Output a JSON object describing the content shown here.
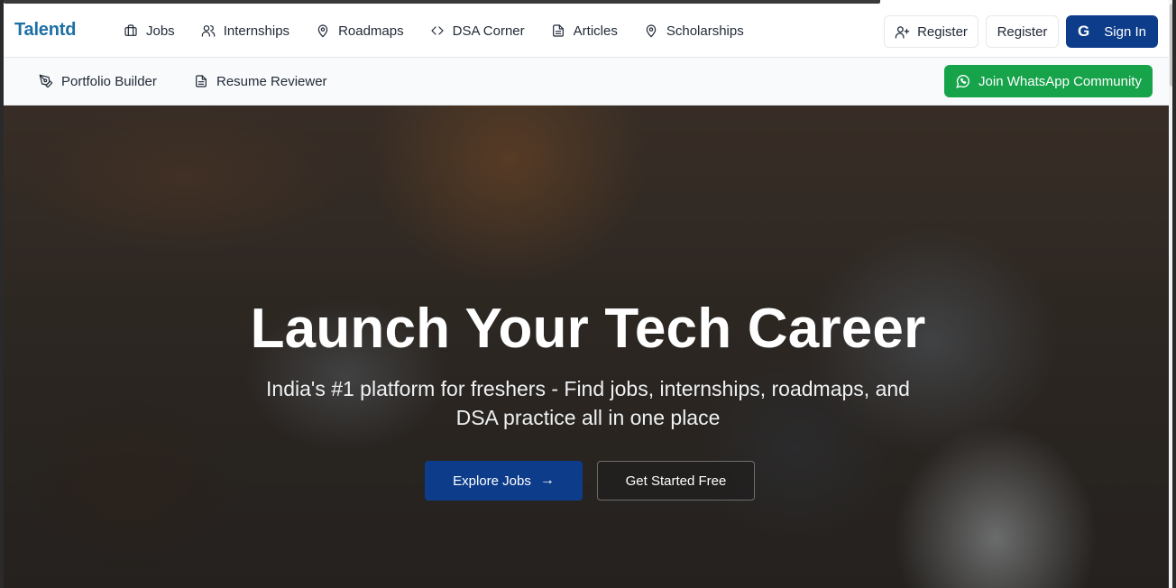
{
  "brand": {
    "name": "Talentd",
    "color": "#1d6fa5"
  },
  "nav_primary": [
    {
      "label": "Jobs",
      "icon": "briefcase-icon"
    },
    {
      "label": "Internships",
      "icon": "users-icon"
    },
    {
      "label": "Roadmaps",
      "icon": "map-pin-icon"
    },
    {
      "label": "DSA Corner",
      "icon": "code-icon"
    },
    {
      "label": "Articles",
      "icon": "file-text-icon"
    },
    {
      "label": "Scholarships",
      "icon": "map-pin-icon"
    }
  ],
  "header_actions": {
    "register_with_icon": "Register",
    "register": "Register",
    "sign_in": "Sign In",
    "sign_in_icon_glyph": "G"
  },
  "nav_secondary": [
    {
      "label": "Portfolio Builder",
      "icon": "pen-tool-icon"
    },
    {
      "label": "Resume Reviewer",
      "icon": "file-text-icon"
    }
  ],
  "whatsapp": {
    "label": "Join WhatsApp Community",
    "color": "#16a34a"
  },
  "hero": {
    "title": "Launch Your Tech Career",
    "subtitle": "India's #1 platform for freshers - Find jobs, internships, roadmaps, and DSA practice all in one place",
    "primary_cta": "Explore Jobs",
    "secondary_cta": "Get Started Free"
  },
  "colors": {
    "primary": "#0d3d8a",
    "accent_green": "#16a34a"
  }
}
